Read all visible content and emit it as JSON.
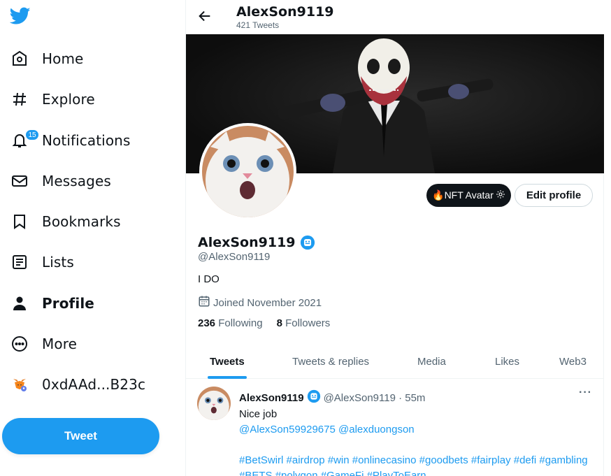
{
  "sidebar": {
    "logo": "twitter-bird-icon",
    "items": [
      {
        "label": "Home",
        "icon": "home-icon"
      },
      {
        "label": "Explore",
        "icon": "hashtag-icon"
      },
      {
        "label": "Notifications",
        "icon": "bell-icon",
        "badge": "15"
      },
      {
        "label": "Messages",
        "icon": "envelope-icon"
      },
      {
        "label": "Bookmarks",
        "icon": "bookmark-icon"
      },
      {
        "label": "Lists",
        "icon": "list-icon"
      },
      {
        "label": "Profile",
        "icon": "person-icon",
        "active": true
      },
      {
        "label": "More",
        "icon": "more-circle-icon"
      },
      {
        "label": "0xdAAd...B23c",
        "icon": "metamask-fox-icon"
      }
    ],
    "tweet_button": "Tweet"
  },
  "header": {
    "title": "AlexSon9119",
    "subtitle": "421 Tweets"
  },
  "profile": {
    "name": "AlexSon9119",
    "handle": "@AlexSon9119",
    "bio": "I DO",
    "joined": "Joined November 2021",
    "following_count": "236",
    "following_label": "Following",
    "followers_count": "8",
    "followers_label": "Followers",
    "nft_button": "🔥NFT Avatar",
    "edit_button": "Edit profile"
  },
  "tabs": [
    {
      "label": "Tweets",
      "active": true
    },
    {
      "label": "Tweets & replies"
    },
    {
      "label": "Media"
    },
    {
      "label": "Likes"
    },
    {
      "label": "Web3"
    }
  ],
  "tweet": {
    "name": "AlexSon9119",
    "meta": "@AlexSon9119 · 55m",
    "text": "Nice job",
    "mentions": "@AlexSon59929675 @alexduongson",
    "hashtags": "#BetSwirl #airdrop #win #onlinecasino #goodbets #fairplay #defi #gambling #BETS #polygon #GameFi #PlayToEarn",
    "more": "···"
  },
  "colors": {
    "accent": "#1d9bf0",
    "text": "#0f1419",
    "muted": "#536471"
  }
}
